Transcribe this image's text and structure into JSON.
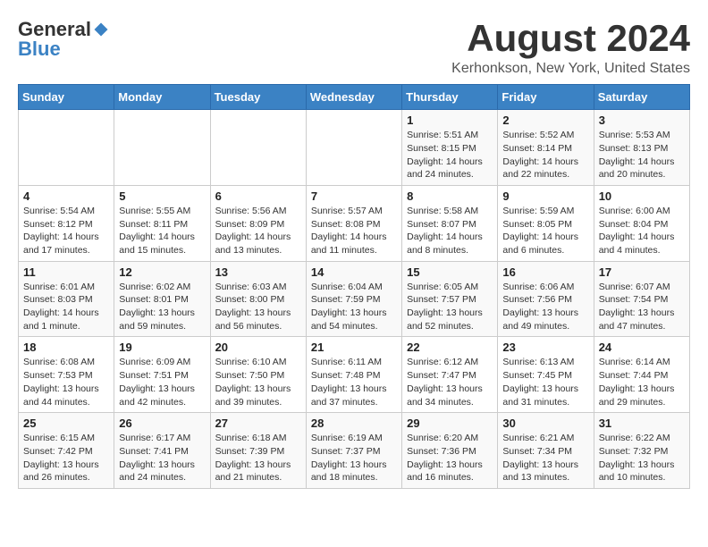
{
  "logo": {
    "general": "General",
    "blue": "Blue"
  },
  "header": {
    "title": "August 2024",
    "subtitle": "Kerhonkson, New York, United States"
  },
  "weekdays": [
    "Sunday",
    "Monday",
    "Tuesday",
    "Wednesday",
    "Thursday",
    "Friday",
    "Saturday"
  ],
  "weeks": [
    [
      {
        "day": "",
        "info": ""
      },
      {
        "day": "",
        "info": ""
      },
      {
        "day": "",
        "info": ""
      },
      {
        "day": "",
        "info": ""
      },
      {
        "day": "1",
        "info": "Sunrise: 5:51 AM\nSunset: 8:15 PM\nDaylight: 14 hours\nand 24 minutes."
      },
      {
        "day": "2",
        "info": "Sunrise: 5:52 AM\nSunset: 8:14 PM\nDaylight: 14 hours\nand 22 minutes."
      },
      {
        "day": "3",
        "info": "Sunrise: 5:53 AM\nSunset: 8:13 PM\nDaylight: 14 hours\nand 20 minutes."
      }
    ],
    [
      {
        "day": "4",
        "info": "Sunrise: 5:54 AM\nSunset: 8:12 PM\nDaylight: 14 hours\nand 17 minutes."
      },
      {
        "day": "5",
        "info": "Sunrise: 5:55 AM\nSunset: 8:11 PM\nDaylight: 14 hours\nand 15 minutes."
      },
      {
        "day": "6",
        "info": "Sunrise: 5:56 AM\nSunset: 8:09 PM\nDaylight: 14 hours\nand 13 minutes."
      },
      {
        "day": "7",
        "info": "Sunrise: 5:57 AM\nSunset: 8:08 PM\nDaylight: 14 hours\nand 11 minutes."
      },
      {
        "day": "8",
        "info": "Sunrise: 5:58 AM\nSunset: 8:07 PM\nDaylight: 14 hours\nand 8 minutes."
      },
      {
        "day": "9",
        "info": "Sunrise: 5:59 AM\nSunset: 8:05 PM\nDaylight: 14 hours\nand 6 minutes."
      },
      {
        "day": "10",
        "info": "Sunrise: 6:00 AM\nSunset: 8:04 PM\nDaylight: 14 hours\nand 4 minutes."
      }
    ],
    [
      {
        "day": "11",
        "info": "Sunrise: 6:01 AM\nSunset: 8:03 PM\nDaylight: 14 hours\nand 1 minute."
      },
      {
        "day": "12",
        "info": "Sunrise: 6:02 AM\nSunset: 8:01 PM\nDaylight: 13 hours\nand 59 minutes."
      },
      {
        "day": "13",
        "info": "Sunrise: 6:03 AM\nSunset: 8:00 PM\nDaylight: 13 hours\nand 56 minutes."
      },
      {
        "day": "14",
        "info": "Sunrise: 6:04 AM\nSunset: 7:59 PM\nDaylight: 13 hours\nand 54 minutes."
      },
      {
        "day": "15",
        "info": "Sunrise: 6:05 AM\nSunset: 7:57 PM\nDaylight: 13 hours\nand 52 minutes."
      },
      {
        "day": "16",
        "info": "Sunrise: 6:06 AM\nSunset: 7:56 PM\nDaylight: 13 hours\nand 49 minutes."
      },
      {
        "day": "17",
        "info": "Sunrise: 6:07 AM\nSunset: 7:54 PM\nDaylight: 13 hours\nand 47 minutes."
      }
    ],
    [
      {
        "day": "18",
        "info": "Sunrise: 6:08 AM\nSunset: 7:53 PM\nDaylight: 13 hours\nand 44 minutes."
      },
      {
        "day": "19",
        "info": "Sunrise: 6:09 AM\nSunset: 7:51 PM\nDaylight: 13 hours\nand 42 minutes."
      },
      {
        "day": "20",
        "info": "Sunrise: 6:10 AM\nSunset: 7:50 PM\nDaylight: 13 hours\nand 39 minutes."
      },
      {
        "day": "21",
        "info": "Sunrise: 6:11 AM\nSunset: 7:48 PM\nDaylight: 13 hours\nand 37 minutes."
      },
      {
        "day": "22",
        "info": "Sunrise: 6:12 AM\nSunset: 7:47 PM\nDaylight: 13 hours\nand 34 minutes."
      },
      {
        "day": "23",
        "info": "Sunrise: 6:13 AM\nSunset: 7:45 PM\nDaylight: 13 hours\nand 31 minutes."
      },
      {
        "day": "24",
        "info": "Sunrise: 6:14 AM\nSunset: 7:44 PM\nDaylight: 13 hours\nand 29 minutes."
      }
    ],
    [
      {
        "day": "25",
        "info": "Sunrise: 6:15 AM\nSunset: 7:42 PM\nDaylight: 13 hours\nand 26 minutes."
      },
      {
        "day": "26",
        "info": "Sunrise: 6:17 AM\nSunset: 7:41 PM\nDaylight: 13 hours\nand 24 minutes."
      },
      {
        "day": "27",
        "info": "Sunrise: 6:18 AM\nSunset: 7:39 PM\nDaylight: 13 hours\nand 21 minutes."
      },
      {
        "day": "28",
        "info": "Sunrise: 6:19 AM\nSunset: 7:37 PM\nDaylight: 13 hours\nand 18 minutes."
      },
      {
        "day": "29",
        "info": "Sunrise: 6:20 AM\nSunset: 7:36 PM\nDaylight: 13 hours\nand 16 minutes."
      },
      {
        "day": "30",
        "info": "Sunrise: 6:21 AM\nSunset: 7:34 PM\nDaylight: 13 hours\nand 13 minutes."
      },
      {
        "day": "31",
        "info": "Sunrise: 6:22 AM\nSunset: 7:32 PM\nDaylight: 13 hours\nand 10 minutes."
      }
    ]
  ]
}
